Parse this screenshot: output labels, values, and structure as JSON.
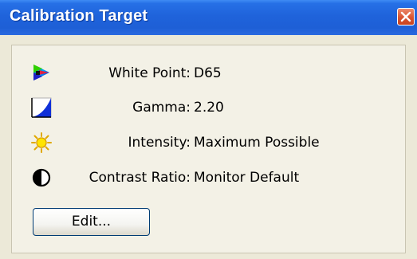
{
  "window": {
    "title": "Calibration Target",
    "close_icon": "close-icon"
  },
  "settings": [
    {
      "label": "White Point:",
      "value": "D65",
      "icon": "color-gamut-icon"
    },
    {
      "label": "Gamma:",
      "value": "2.20",
      "icon": "gamma-curve-icon"
    },
    {
      "label": "Intensity:",
      "value": "Maximum Possible",
      "icon": "sun-icon"
    },
    {
      "label": "Contrast Ratio:",
      "value": "Monitor Default",
      "icon": "contrast-icon"
    }
  ],
  "actions": {
    "edit_label": "Edit..."
  },
  "colors": {
    "titlebar": "#1f63db",
    "close_button": "#d95431",
    "panel_background": "#ece9d8"
  }
}
